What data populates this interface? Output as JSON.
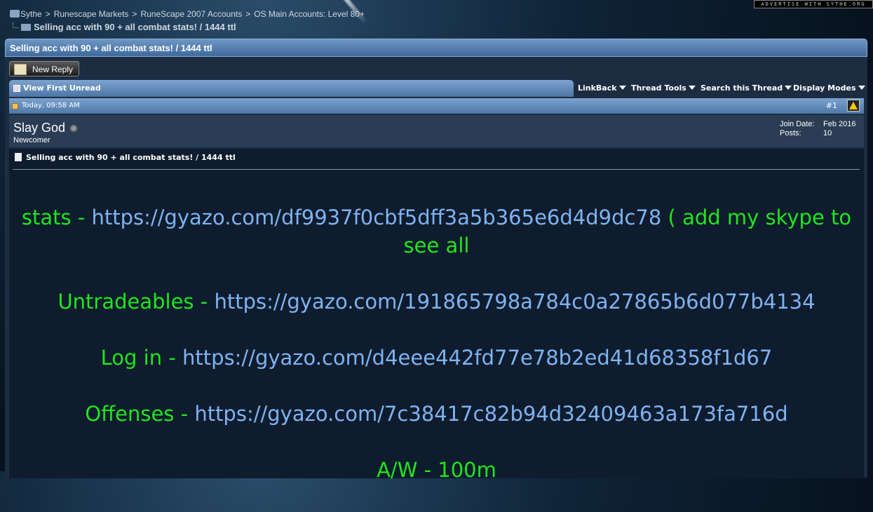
{
  "advertise": "ADVERTISE WITH SYTHE.ORG",
  "breadcrumb": [
    "Sythe",
    "Runescape Markets",
    "RuneScape 2007 Accounts",
    "OS Main Accounts: Level 80+"
  ],
  "thread_title": "Selling acc with 90 + all combat stats! / 1444 ttl",
  "new_reply_label": "New Reply",
  "view_first_unread": "View First Unread",
  "tools": {
    "linkback": "LinkBack",
    "thread_tools": "Thread Tools",
    "search": "Search this Thread",
    "display_modes": "Display Modes"
  },
  "post": {
    "date": "Today, 09:58 AM",
    "number": "#1",
    "username": "Slay God",
    "user_title": "Newcomer",
    "join_date_label": "Join Date:",
    "join_date": "Feb 2016",
    "posts_label": "Posts:",
    "posts": "10",
    "title": "Selling acc with 90 + all combat stats! / 1444 ttl",
    "lines": [
      {
        "label": "stats - ",
        "link": "https://gyazo.com/df9937f0cbf5dff3a5b365e6d4d9dc78",
        "suffix": " ( add my skype to see all"
      },
      {
        "label": "Untradeables - ",
        "link": "https://gyazo.com/191865798a784c0a27865b6d077b4134",
        "suffix": ""
      },
      {
        "label": "Log in - ",
        "link": "https://gyazo.com/d4eee442fd77e78b2ed41d68358f1d67",
        "suffix": ""
      },
      {
        "label": "Offenses - ",
        "link": "https://gyazo.com/7c38417c82b94d32409463a173fa716d",
        "suffix": ""
      },
      {
        "label": "A/W - 100m",
        "link": "",
        "suffix": ""
      }
    ]
  },
  "colors": {
    "label_green": "#1ee61e",
    "link_blue": "#7fb3f0",
    "header_blue": "#4f78a8"
  }
}
